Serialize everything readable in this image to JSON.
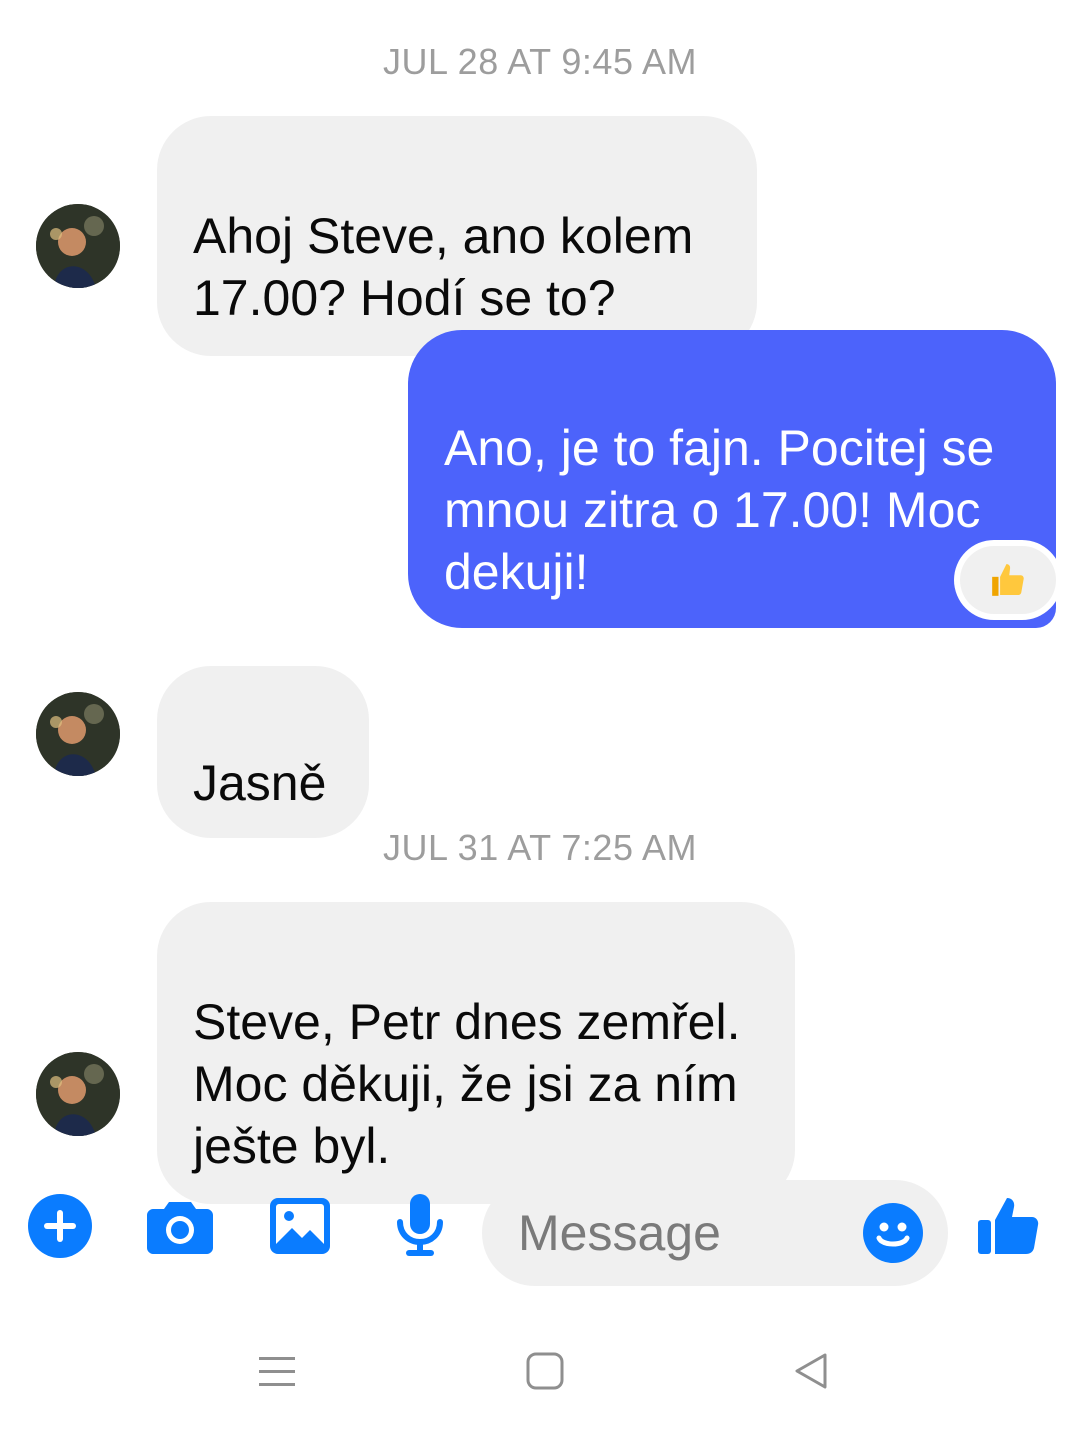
{
  "thread": {
    "timestamps": [
      "JUL 28 AT 9:45 AM",
      "JUL 31 AT 7:25 AM"
    ],
    "messages": [
      {
        "direction": "incoming",
        "text": "Ahoj Steve,  ano kolem\n17.00? Hodí se to?"
      },
      {
        "direction": "outgoing",
        "text": "Ano, je to fajn. Pocitej se\nmnou zitra o 17.00! Moc\ndekuji!",
        "reaction": "thumbs-up"
      },
      {
        "direction": "incoming",
        "text": "Jasně"
      },
      {
        "direction": "incoming",
        "text": "Steve, Petr dnes zemřel.\nMoc děkuji, že jsi za ním\nješte byl."
      }
    ]
  },
  "composer": {
    "placeholder": "Message",
    "icons": [
      "plus-icon",
      "camera-icon",
      "image-icon",
      "microphone-icon",
      "emoji-icon",
      "thumbs-up-icon"
    ]
  },
  "colors": {
    "accent": "#0a7cff",
    "outgoing_bubble": "#4c63fb",
    "incoming_bubble": "#f0f0f0",
    "timestamp": "#9d9d9d"
  },
  "system_nav": {
    "icons": [
      "menu-icon",
      "home-icon",
      "back-icon"
    ]
  }
}
